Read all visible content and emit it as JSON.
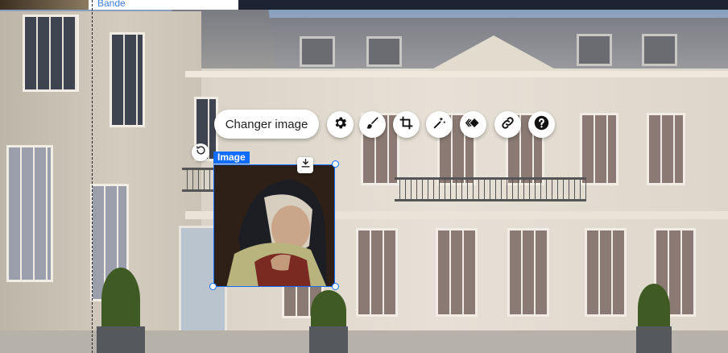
{
  "strip": {
    "label": "Bande"
  },
  "toolbar": {
    "change_image_label": "Changer image",
    "tools": [
      {
        "icon": "gear-icon"
      },
      {
        "icon": "paint-brush-icon"
      },
      {
        "icon": "crop-icon"
      },
      {
        "icon": "magic-wand-icon"
      },
      {
        "icon": "animation-icon"
      },
      {
        "icon": "link-icon"
      },
      {
        "icon": "help-icon"
      }
    ]
  },
  "selection": {
    "type_label": "Image"
  },
  "colors": {
    "accent": "#116dff",
    "topbar": "#1c2333"
  }
}
